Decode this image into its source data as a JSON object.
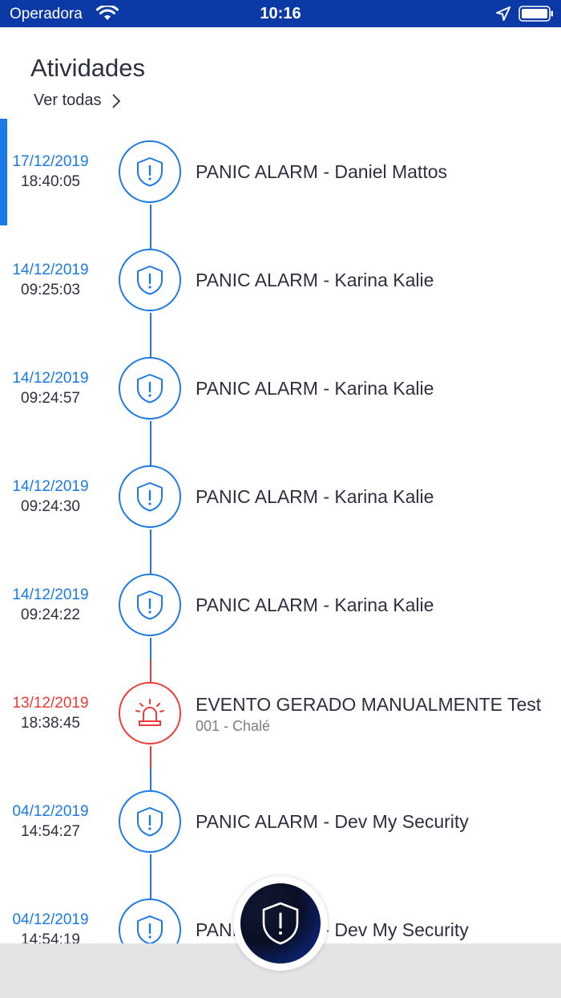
{
  "status_bar": {
    "carrier": "Operadora",
    "time": "10:16",
    "wifi_icon": "wifi-icon",
    "location_icon": "location-arrow-icon",
    "battery_icon": "battery-icon"
  },
  "header": {
    "title": "Atividades",
    "see_all_label": "Ver todas"
  },
  "colors": {
    "accent_blue": "#1b7ae6",
    "alert_red": "#ee3b37",
    "status_bar": "#0b3aa6"
  },
  "activities": [
    {
      "date": "17/12/2019",
      "time": "18:40:05",
      "title": "PANIC ALARM  - Daniel Mattos",
      "subtitle": "",
      "icon": "shield-alert-icon",
      "type": "panic",
      "selected": true
    },
    {
      "date": "14/12/2019",
      "time": "09:25:03",
      "title": "PANIC ALARM  - Karina Kalie",
      "subtitle": "",
      "icon": "shield-alert-icon",
      "type": "panic"
    },
    {
      "date": "14/12/2019",
      "time": "09:24:57",
      "title": "PANIC ALARM  - Karina Kalie",
      "subtitle": "",
      "icon": "shield-alert-icon",
      "type": "panic"
    },
    {
      "date": "14/12/2019",
      "time": "09:24:30",
      "title": "PANIC ALARM  - Karina Kalie",
      "subtitle": "",
      "icon": "shield-alert-icon",
      "type": "panic"
    },
    {
      "date": "14/12/2019",
      "time": "09:24:22",
      "title": "PANIC ALARM  - Karina Kalie",
      "subtitle": "",
      "icon": "shield-alert-icon",
      "type": "panic"
    },
    {
      "date": "13/12/2019",
      "time": "18:38:45",
      "title": "EVENTO GERADO MANUALMENTE Test",
      "subtitle": "001 - Chalé",
      "icon": "siren-icon",
      "type": "manual"
    },
    {
      "date": "04/12/2019",
      "time": "14:54:27",
      "title": "PANIC ALARM  - Dev My Security",
      "subtitle": "",
      "icon": "shield-alert-icon",
      "type": "panic"
    },
    {
      "date": "04/12/2019",
      "time": "14:54:19",
      "title": "PANIC ALARM  - Dev My Security",
      "subtitle": "",
      "icon": "shield-alert-icon",
      "type": "panic"
    }
  ],
  "panic_button": {
    "icon": "shield-alert-icon"
  }
}
